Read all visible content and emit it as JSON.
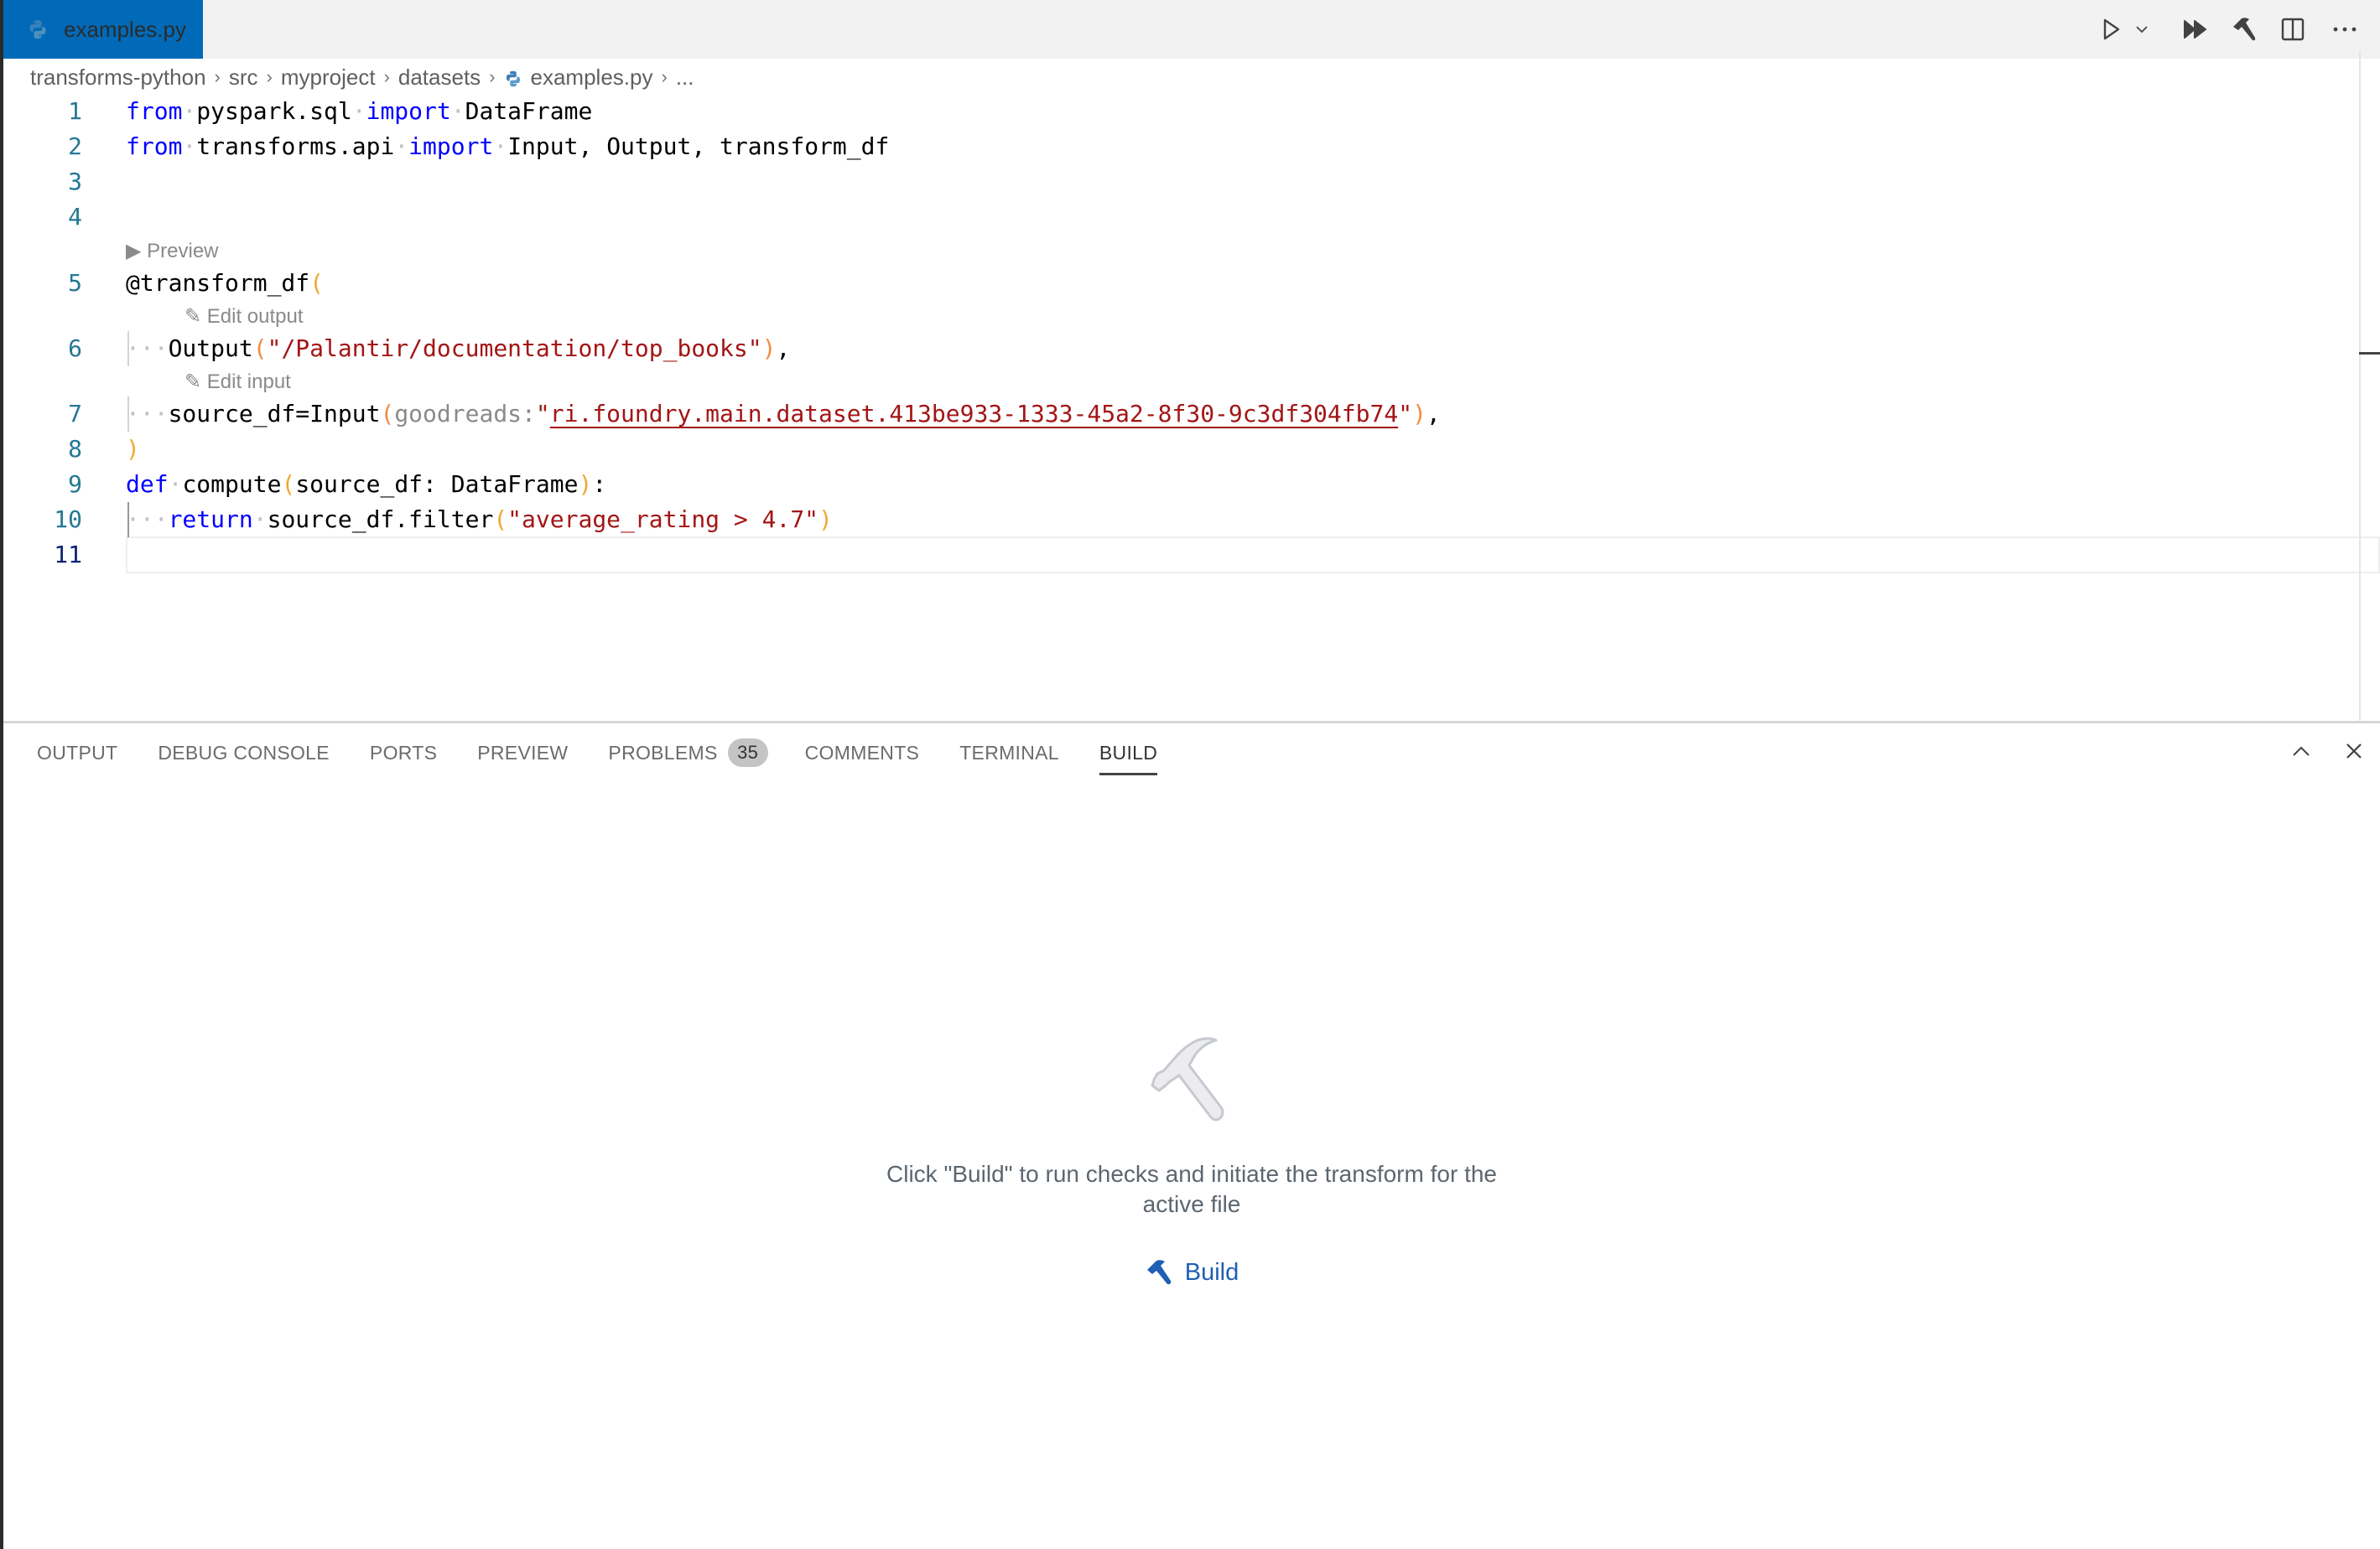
{
  "tab": {
    "filename": "examples.py",
    "icon": "python-icon"
  },
  "toolbar": {
    "buttons": [
      {
        "name": "run",
        "icon": "play-icon"
      },
      {
        "name": "run-options",
        "icon": "chevron-down-icon"
      },
      {
        "name": "run-all",
        "icon": "fast-forward-icon"
      },
      {
        "name": "build",
        "icon": "hammer-icon"
      },
      {
        "name": "split-editor",
        "icon": "split-editor-icon"
      },
      {
        "name": "more-actions",
        "icon": "ellipsis-icon"
      }
    ]
  },
  "breadcrumb": {
    "items": [
      "transforms-python",
      "src",
      "myproject",
      "datasets",
      "examples.py",
      "..."
    ],
    "separator": "›"
  },
  "editor": {
    "line_numbers": [
      "1",
      "2",
      "3",
      "4",
      "5",
      "6",
      "7",
      "8",
      "9",
      "10",
      "11"
    ],
    "current_line": "11",
    "codelens": {
      "preview": "Preview",
      "edit_output": "Edit output",
      "edit_input": "Edit input"
    },
    "lines": {
      "l1": {
        "kw1": "from",
        "mod": "pyspark.sql",
        "kw2": "import",
        "name": "DataFrame"
      },
      "l2": {
        "kw1": "from",
        "mod": "transforms.api",
        "kw2": "import",
        "names": "Input, Output, transform_df"
      },
      "l5": {
        "decorator": "@transform_df",
        "open": "("
      },
      "l6": {
        "fn": "Output",
        "open": "(",
        "str": "\"/Palantir/documentation/top_books\"",
        "close": ")",
        "tail": ","
      },
      "l7": {
        "lhs": "source_df=Input",
        "open": "(",
        "hint": "goodreads:",
        "quote_open": "\"",
        "rid": "ri.foundry.main.dataset.413be933-1333-45a2-8f30-9c3df304fb74",
        "quote_close": "\"",
        "close": ")",
        "tail": ","
      },
      "l8": {
        "close": ")"
      },
      "l9": {
        "kw": "def",
        "fn": "compute",
        "open": "(",
        "params": "source_df: DataFrame",
        "close": ")",
        "tail": ":"
      },
      "l10": {
        "kw": "return",
        "call": "source_df.filter",
        "open": "(",
        "str": "\"average_rating > 4.7\"",
        "close": ")"
      }
    }
  },
  "panel": {
    "tabs": [
      {
        "label": "OUTPUT"
      },
      {
        "label": "DEBUG CONSOLE"
      },
      {
        "label": "PORTS"
      },
      {
        "label": "PREVIEW"
      },
      {
        "label": "PROBLEMS",
        "badge": "35"
      },
      {
        "label": "COMMENTS"
      },
      {
        "label": "TERMINAL"
      },
      {
        "label": "BUILD",
        "active": true
      }
    ],
    "actions": {
      "maximize": "chevron-up-icon",
      "close": "close-icon"
    },
    "empty_state": {
      "message": "Click \"Build\" to run checks and initiate the transform for the active file",
      "button_label": "Build"
    }
  },
  "colors": {
    "tab_active_bg": "#006ab8",
    "keyword": "#0000ff",
    "string": "#a31515",
    "line_number": "#237893",
    "build_link": "#1f5fb4"
  }
}
